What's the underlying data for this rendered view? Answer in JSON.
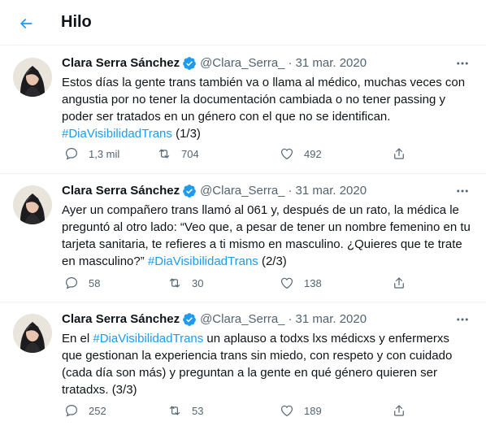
{
  "header": {
    "title": "Hilo"
  },
  "tweets": [
    {
      "author": "Clara Serra Sánchez",
      "handle": "@Clara_Serra_",
      "separator": "·",
      "date": "31 mar. 2020",
      "text": "Estos días la gente trans también va o llama al médico, muchas veces con angustia por no tener la documentación cambiada o no tener passing y poder ser tratados en un género con el que no se identifican.",
      "hashtag": "#DiaVisibilidadTrans",
      "suffix": " (1/3)",
      "replies": "1,3 mil",
      "retweets": "704",
      "likes": "492"
    },
    {
      "author": "Clara Serra Sánchez",
      "handle": "@Clara_Serra_",
      "separator": "·",
      "date": "31 mar. 2020",
      "text": "Ayer un compañero trans llamó al 061 y, después de un rato, la médica le preguntó al otro lado: “Veo que, a pesar de tener un nombre femenino en tu tarjeta sanitaria, te refieres a ti mismo en masculino. ¿Quieres que te trate en masculino?”",
      "hashtag": "#DiaVisibilidadTrans",
      "suffix": " (2/3)",
      "replies": "58",
      "retweets": "30",
      "likes": "138"
    },
    {
      "author": "Clara Serra Sánchez",
      "handle": "@Clara_Serra_",
      "separator": "·",
      "date": "31 mar. 2020",
      "prefix": "En el ",
      "hashtag": "#DiaVisibilidadTrans",
      "text": " un aplauso a todxs lxs médicxs y enfermerxs que gestionan la experiencia trans sin miedo, con respeto y con cuidado (cada día son más) y preguntan a la gente en qué género quieren ser tratadxs. (3/3)",
      "replies": "252",
      "retweets": "53",
      "likes": "189"
    }
  ],
  "colors": {
    "accent": "#1d9bf0",
    "muted": "#536471",
    "divider": "#eff3f4"
  },
  "icons": [
    "back-arrow-icon",
    "verified-badge-icon",
    "more-icon",
    "reply-icon",
    "retweet-icon",
    "like-icon",
    "share-icon"
  ]
}
